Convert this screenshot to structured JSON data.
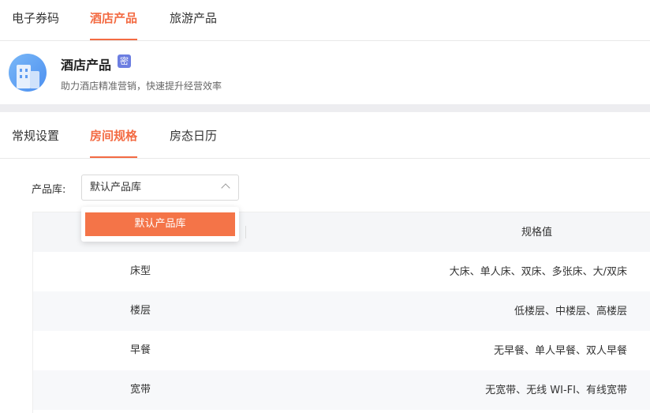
{
  "top_tabs": [
    {
      "label": "电子券码"
    },
    {
      "label": "酒店产品"
    },
    {
      "label": "旅游产品"
    }
  ],
  "product": {
    "title": "酒店产品",
    "badge": "密",
    "description": "助力酒店精准营销，快速提升经营效率"
  },
  "sub_tabs": [
    {
      "label": "常规设置"
    },
    {
      "label": "房间规格"
    },
    {
      "label": "房态日历"
    }
  ],
  "library": {
    "label": "产品库:",
    "selected": "默认产品库",
    "options": [
      "默认产品库"
    ]
  },
  "table": {
    "value_header": "规格值",
    "rows": [
      {
        "name": "床型",
        "value": "大床、单人床、双床、多张床、大/双床"
      },
      {
        "name": "楼层",
        "value": "低楼层、中楼层、高楼层"
      },
      {
        "name": "早餐",
        "value": "无早餐、单人早餐、双人早餐"
      },
      {
        "name": "宽带",
        "value": "无宽带、无线 WI-FI、有线宽带"
      }
    ]
  },
  "colors": {
    "accent": "#f36b43",
    "option_highlight": "#f47448",
    "badge": "#6c7ee1",
    "divider": "#ededf0"
  },
  "icons": {
    "product": "hotel-building-icon",
    "select": "chevron-up-icon"
  }
}
